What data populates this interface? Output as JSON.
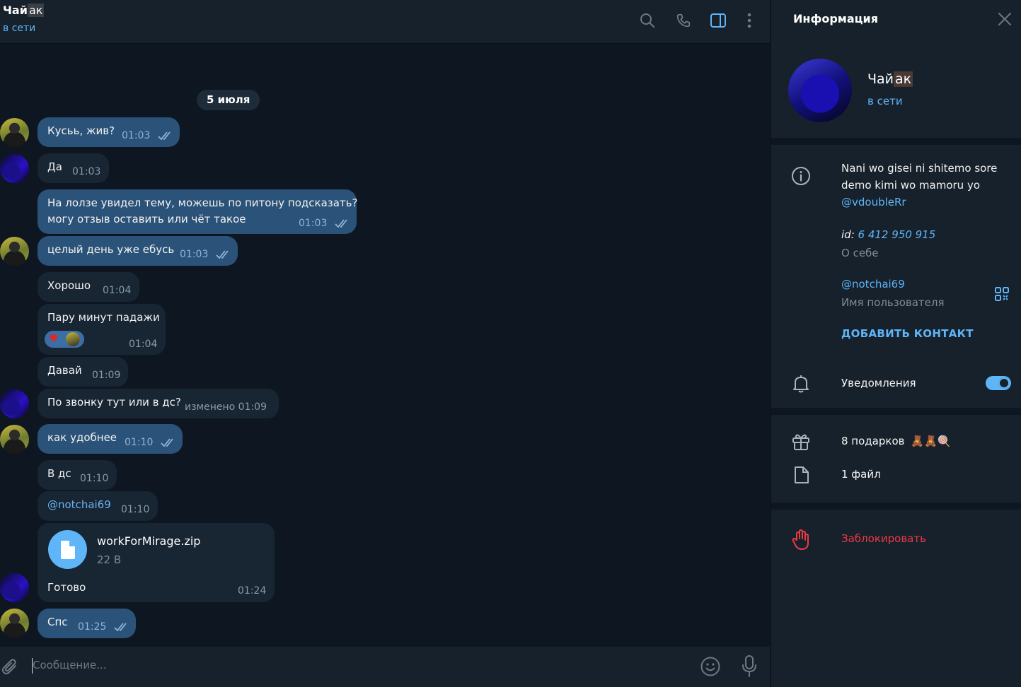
{
  "chat": {
    "title": "Чай",
    "title_tag": "ак",
    "status": "в сети",
    "date_separator": "5 июля",
    "composer_placeholder": "Сообщение..."
  },
  "messages": [
    {
      "text": "Кусьь, жив?",
      "time": "01:03",
      "outgoing": true
    },
    {
      "text": "Да",
      "time": "01:03",
      "outgoing": false
    },
    {
      "line1": "На лолзе увидел тему, можешь по питону подсказать?",
      "line2": "могу отзыв оставить или чёт такое",
      "time": "01:03",
      "outgoing": true
    },
    {
      "text": "целый день уже ебусь",
      "time": "01:03",
      "outgoing": true
    },
    {
      "text": "Хорошо",
      "time": "01:04",
      "outgoing": false
    },
    {
      "text": "Пару минут падажи",
      "time": "01:04",
      "outgoing": false
    },
    {
      "text": "Давай",
      "time": "01:09",
      "outgoing": false
    },
    {
      "text": "По звонку тут или в дс?",
      "time": "изменено 01:09",
      "outgoing": false
    },
    {
      "text": "как удобнее",
      "time": "01:10",
      "outgoing": true
    },
    {
      "text": "В дс",
      "time": "01:10",
      "outgoing": false
    },
    {
      "text": "@notchai69",
      "time": "01:10",
      "outgoing": false
    },
    {
      "file_name": "workForMirage.zip",
      "file_size": "22 B",
      "caption": "Готово",
      "time": "01:24",
      "outgoing": false
    },
    {
      "text": "Спс",
      "time": "01:25",
      "outgoing": true
    }
  ],
  "info": {
    "title": "Информация",
    "name": "Чай",
    "name_tag": "ак",
    "status": "в сети",
    "bio_text": "Nani wo gisei ni shitemo sore demo kimi wo mamoru yo",
    "bio_link": "@vdoubleRr",
    "id_label": "id:",
    "id_value": "6 412 950 915",
    "bio_caption": "О себе",
    "username": "@notchai69",
    "username_caption": "Имя пользователя",
    "add_contact": "ДОБАВИТЬ КОНТАКТ",
    "notifications": "Уведомления",
    "notifications_on": true,
    "gifts": "8 подарков",
    "files": "1 файл",
    "block": "Заблокировать"
  },
  "colors": {
    "background": "#0e1621",
    "panel": "#17212b",
    "bubble_in": "#182533",
    "bubble_out": "#2b5278",
    "accent": "#5eb5f7",
    "danger": "#ec3942"
  }
}
